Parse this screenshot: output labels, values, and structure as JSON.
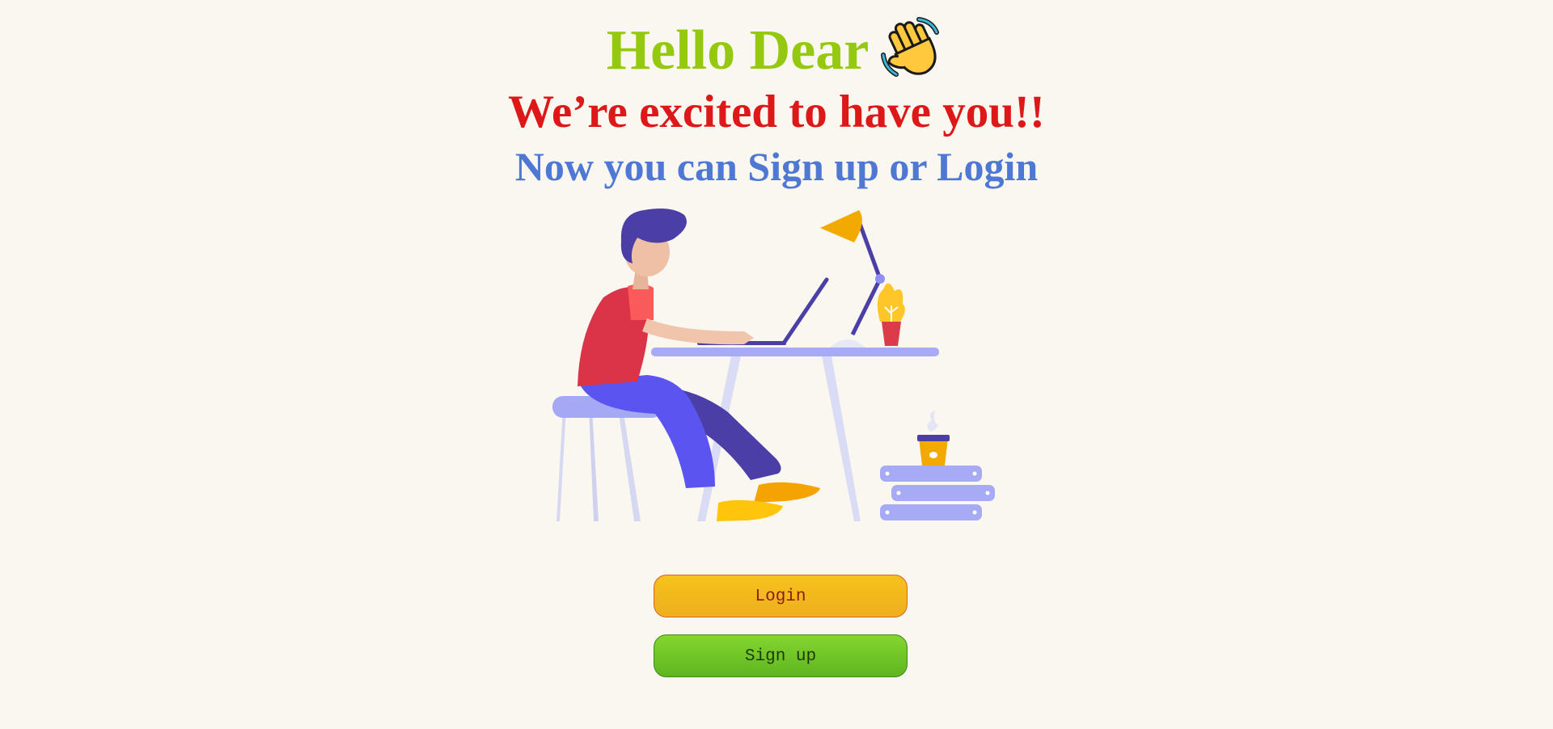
{
  "header": {
    "greeting": "Hello Dear",
    "wave_icon": "waving-hand-icon",
    "tagline": "We’re excited to have you!!",
    "prompt": "Now you can Sign up or Login"
  },
  "illustration": {
    "subject": "person-working-at-laptop-illustration"
  },
  "actions": {
    "login_label": "Login",
    "signup_label": "Sign up"
  },
  "colors": {
    "background": "#faf7f0",
    "greeting": "#95c90f",
    "tagline": "#dc1818",
    "prompt": "#4e78d4",
    "login_button": "#f6c21c",
    "signup_button": "#84d62f"
  }
}
